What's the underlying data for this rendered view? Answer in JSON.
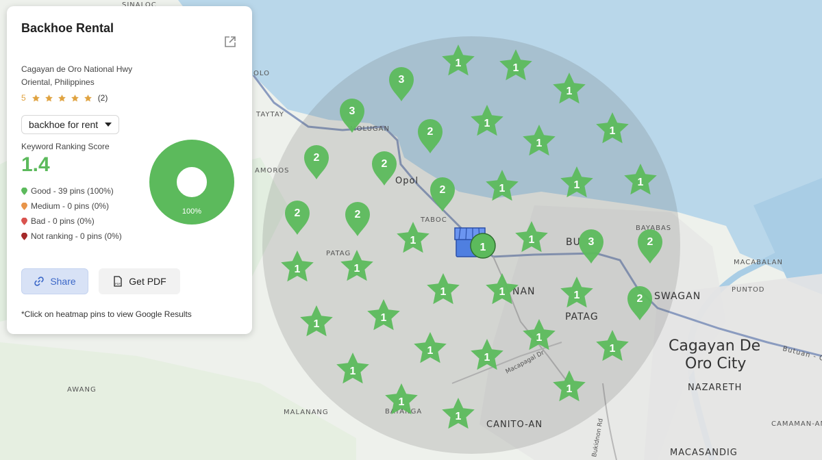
{
  "business": {
    "title": "Backhoe Rental",
    "address_line1": "Cagayan de Oro National Hwy",
    "address_line2": "Oriental, Philippines",
    "rating_value": "5",
    "review_count": "(2)"
  },
  "keyword": {
    "selected": "backhoe for rent"
  },
  "score": {
    "label": "Keyword Ranking Score",
    "value": "1.4"
  },
  "legend": {
    "good": "Good - 39 pins (100%)",
    "medium": "Medium - 0 pins (0%)",
    "bad": "Bad - 0 pins (0%)",
    "not_ranking": "Not ranking - 0 pins (0%)"
  },
  "donut": {
    "label": "100%",
    "good_fraction": 1.0
  },
  "buttons": {
    "share": "Share",
    "pdf": "Get PDF"
  },
  "footnote": "*Click on heatmap pins to view Google Results",
  "colors": {
    "good": "#5cba5c",
    "medium": "#e8954a",
    "bad": "#d9534f",
    "not_ranking": "#a52a2a",
    "share_text": "#3c68c8"
  },
  "map_labels": {
    "sinaloc": "SINALOC",
    "olo": "OLO",
    "taytay": "TAYTAY",
    "molugan": "MOLUGAN",
    "amoros": "AMOROS",
    "opol": "Opol",
    "taboc": "TABOC",
    "patag_w": "PATAG",
    "bu": "BU",
    "bayabas": "BAYABAS",
    "macabalan": "MACABALAN",
    "puntod": "PUNTOD",
    "swagan": "SWAGAN",
    "nan": "NAN",
    "patag_e": "PATAG",
    "city_line1": "Cagayan De",
    "city_line2": "Oro City",
    "butuan": "Butuan - Cag",
    "macapagal": "Macapagal Dr",
    "nazareth": "NAZARETH",
    "awang": "AWANG",
    "malanang": "MALANANG",
    "bayanga": "BAYANGA",
    "canitoan": "CANITO-AN",
    "bukidnon": "Bukidnon Rd",
    "camaman": "CAMAMAN-AN",
    "macasandig": "MACASANDIG"
  },
  "pins": [
    {
      "type": "star",
      "rank": "1"
    },
    {
      "type": "star",
      "rank": "1"
    },
    {
      "type": "star",
      "rank": "1"
    },
    {
      "type": "star",
      "rank": "1"
    },
    {
      "type": "star",
      "rank": "1"
    },
    {
      "type": "star",
      "rank": "1"
    },
    {
      "type": "star",
      "rank": "1"
    },
    {
      "type": "star",
      "rank": "1"
    },
    {
      "type": "star",
      "rank": "1"
    },
    {
      "type": "star",
      "rank": "1"
    },
    {
      "type": "star",
      "rank": "1"
    },
    {
      "type": "star",
      "rank": "1"
    },
    {
      "type": "star",
      "rank": "1"
    },
    {
      "type": "star",
      "rank": "1"
    },
    {
      "type": "star",
      "rank": "1"
    },
    {
      "type": "star",
      "rank": "1"
    },
    {
      "type": "star",
      "rank": "1"
    },
    {
      "type": "star",
      "rank": "1"
    },
    {
      "type": "star",
      "rank": "1"
    },
    {
      "type": "star",
      "rank": "1"
    },
    {
      "type": "star",
      "rank": "1"
    },
    {
      "type": "star",
      "rank": "1"
    },
    {
      "type": "star",
      "rank": "1"
    },
    {
      "type": "star",
      "rank": "1"
    },
    {
      "type": "star",
      "rank": "1"
    },
    {
      "type": "star",
      "rank": "1"
    },
    {
      "type": "marker",
      "rank": "3"
    },
    {
      "type": "marker",
      "rank": "3"
    },
    {
      "type": "marker",
      "rank": "2"
    },
    {
      "type": "marker",
      "rank": "2"
    },
    {
      "type": "marker",
      "rank": "2"
    },
    {
      "type": "marker",
      "rank": "2"
    },
    {
      "type": "marker",
      "rank": "2"
    },
    {
      "type": "marker",
      "rank": "2"
    },
    {
      "type": "marker",
      "rank": "3"
    },
    {
      "type": "marker",
      "rank": "2"
    },
    {
      "type": "marker",
      "rank": "2"
    },
    {
      "type": "business",
      "rank": "1"
    }
  ]
}
